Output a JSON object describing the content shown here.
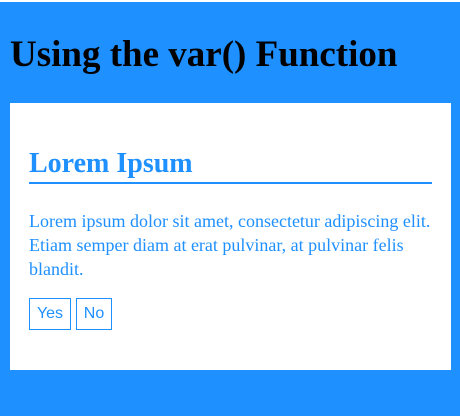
{
  "page": {
    "title": "Using the var() Function",
    "background_color": "#1e90ff"
  },
  "card": {
    "heading": "Lorem Ipsum",
    "text": "Lorem ipsum dolor sit amet, consectetur adipiscing elit. Etiam semper diam at erat pulvinar, at pulvinar felis blandit.",
    "accent_color": "#1e90ff",
    "buttons": {
      "yes_label": "Yes",
      "no_label": "No"
    }
  }
}
